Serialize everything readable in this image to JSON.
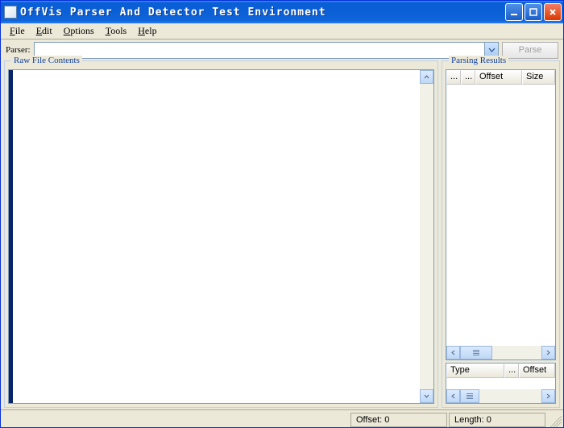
{
  "title": "OffVis Parser And Detector Test Environment",
  "menu": {
    "file": "File",
    "edit": "Edit",
    "options": "Options",
    "tools": "Tools",
    "help": "Help"
  },
  "toolbar": {
    "parser_label": "Parser:",
    "parser_value": "",
    "parse_button": "Parse"
  },
  "panels": {
    "raw_title": "Raw File Contents",
    "results_title": "Parsing Results"
  },
  "results_columns": {
    "c1": "...",
    "c2": "...",
    "offset": "Offset",
    "size": "Size"
  },
  "grid2_columns": {
    "type": "Type",
    "dots": "...",
    "offset": "Offset"
  },
  "status": {
    "offset_label": "Offset:",
    "offset_value": "0",
    "length_label": "Length:",
    "length_value": "0"
  }
}
